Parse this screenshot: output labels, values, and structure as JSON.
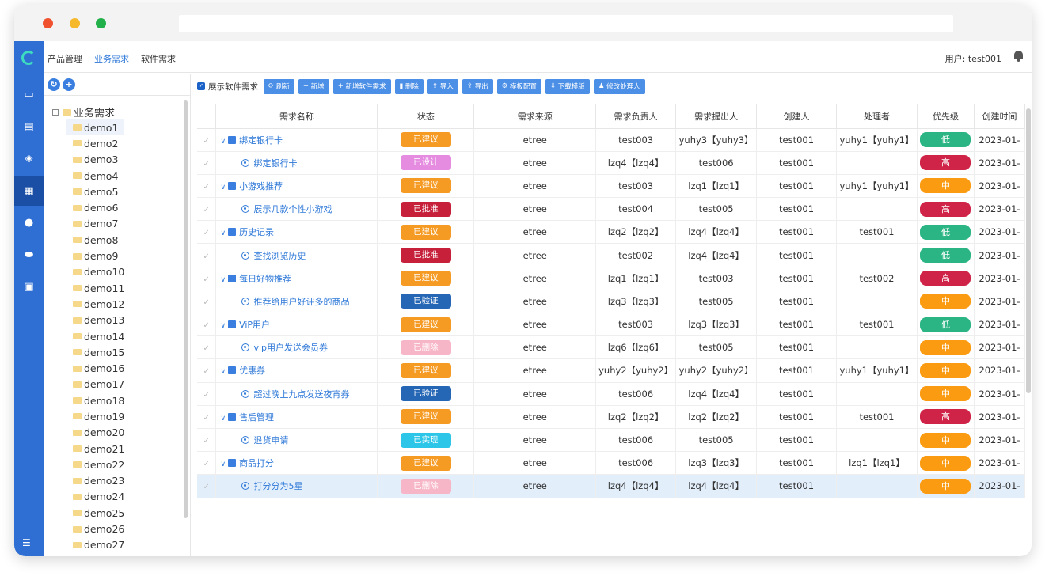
{
  "colors": {
    "brand": "#2f6fd3",
    "status": {
      "已建议": "#f59a23",
      "已设计": "#e58be0",
      "已批准": "#c6203a",
      "已验证": "#2566b5",
      "已删除": "#f7b6c7",
      "已实现": "#2ec6e8"
    },
    "priority": {
      "低": "#2bb584",
      "高": "#cf2448",
      "中": "#fb9b12"
    }
  },
  "window_dots": [
    "#f0512f",
    "#f5b92b",
    "#21b04a"
  ],
  "rail_icons": [
    "logo-icon",
    "monitor-icon",
    "document-icon",
    "layers-icon",
    "server-icon",
    "clock-icon",
    "database-icon",
    "report-icon",
    "menu-icon"
  ],
  "nav": {
    "items": [
      "产品管理",
      "业务需求",
      "软件需求"
    ],
    "active": 1
  },
  "user": {
    "label": "用户: test001"
  },
  "tree": {
    "root": "业务需求",
    "items": [
      "demo1",
      "demo2",
      "demo3",
      "demo4",
      "demo5",
      "demo6",
      "demo7",
      "demo8",
      "demo9",
      "demo10",
      "demo11",
      "demo12",
      "demo13",
      "demo14",
      "demo15",
      "demo16",
      "demo17",
      "demo18",
      "demo19",
      "demo20",
      "demo21",
      "demo22",
      "demo23",
      "demo24",
      "demo25",
      "demo26",
      "demo27"
    ]
  },
  "toolbar": {
    "checkbox_label": "展示软件需求",
    "buttons": [
      "刷新",
      "新增",
      "新增软件需求",
      "删除",
      "导入",
      "导出",
      "模板配置",
      "下载模版",
      "修改处理人"
    ]
  },
  "table": {
    "columns": [
      "需求名称",
      "状态",
      "需求来源",
      "需求负责人",
      "需求提出人",
      "创建人",
      "处理者",
      "优先级",
      "创建时间"
    ],
    "rows": [
      {
        "level": "parent",
        "name": "绑定银行卡",
        "status": "已建议",
        "source": "etree",
        "owner": "test003",
        "proposer": "yuhy3【yuhy3】",
        "creator": "test001",
        "handler": "yuhy1【yuhy1】",
        "priority": "低",
        "created": "2023-01-"
      },
      {
        "level": "child",
        "name": "绑定银行卡",
        "status": "已设计",
        "source": "etree",
        "owner": "lzq4【lzq4】",
        "proposer": "test006",
        "creator": "test001",
        "handler": "",
        "priority": "高",
        "created": "2023-01-"
      },
      {
        "level": "parent",
        "name": "小游戏推荐",
        "status": "已建议",
        "source": "etree",
        "owner": "test003",
        "proposer": "lzq1【lzq1】",
        "creator": "test001",
        "handler": "yuhy1【yuhy1】",
        "priority": "中",
        "created": "2023-01-"
      },
      {
        "level": "child",
        "name": "展示几款个性小游戏",
        "status": "已批准",
        "source": "etree",
        "owner": "test004",
        "proposer": "test005",
        "creator": "test001",
        "handler": "",
        "priority": "高",
        "created": "2023-01-"
      },
      {
        "level": "parent",
        "name": "历史记录",
        "status": "已建议",
        "source": "etree",
        "owner": "lzq2【lzq2】",
        "proposer": "lzq4【lzq4】",
        "creator": "test001",
        "handler": "test001",
        "priority": "低",
        "created": "2023-01-"
      },
      {
        "level": "child",
        "name": "查找浏览历史",
        "status": "已批准",
        "source": "etree",
        "owner": "test002",
        "proposer": "lzq4【lzq4】",
        "creator": "test001",
        "handler": "",
        "priority": "低",
        "created": "2023-01-"
      },
      {
        "level": "parent",
        "name": "每日好物推荐",
        "status": "已建议",
        "source": "etree",
        "owner": "lzq1【lzq1】",
        "proposer": "test003",
        "creator": "test001",
        "handler": "test002",
        "priority": "高",
        "created": "2023-01-"
      },
      {
        "level": "child",
        "name": "推荐给用户好评多的商品",
        "status": "已验证",
        "source": "etree",
        "owner": "lzq3【lzq3】",
        "proposer": "test005",
        "creator": "test001",
        "handler": "",
        "priority": "中",
        "created": "2023-01-"
      },
      {
        "level": "parent",
        "name": "ViP用户",
        "status": "已建议",
        "source": "etree",
        "owner": "test003",
        "proposer": "lzq3【lzq3】",
        "creator": "test001",
        "handler": "test001",
        "priority": "低",
        "created": "2023-01-"
      },
      {
        "level": "child",
        "name": "vip用户发送会员券",
        "status": "已删除",
        "source": "etree",
        "owner": "lzq6【lzq6】",
        "proposer": "test005",
        "creator": "test001",
        "handler": "",
        "priority": "中",
        "created": "2023-01-"
      },
      {
        "level": "parent",
        "name": "优惠券",
        "status": "已建议",
        "source": "etree",
        "owner": "yuhy2【yuhy2】",
        "proposer": "yuhy2【yuhy2】",
        "creator": "test001",
        "handler": "yuhy1【yuhy1】",
        "priority": "中",
        "created": "2023-01-"
      },
      {
        "level": "child",
        "name": "超过晚上九点发送夜宵券",
        "status": "已验证",
        "source": "etree",
        "owner": "test006",
        "proposer": "lzq4【lzq4】",
        "creator": "test001",
        "handler": "",
        "priority": "中",
        "created": "2023-01-"
      },
      {
        "level": "parent",
        "name": "售后管理",
        "status": "已建议",
        "source": "etree",
        "owner": "lzq2【lzq2】",
        "proposer": "lzq2【lzq2】",
        "creator": "test001",
        "handler": "test001",
        "priority": "高",
        "created": "2023-01-"
      },
      {
        "level": "child",
        "name": "退货申请",
        "status": "已实现",
        "source": "etree",
        "owner": "test006",
        "proposer": "test005",
        "creator": "test001",
        "handler": "",
        "priority": "中",
        "created": "2023-01-"
      },
      {
        "level": "parent",
        "name": "商品打分",
        "status": "已建议",
        "source": "etree",
        "owner": "test006",
        "proposer": "lzq3【lzq3】",
        "creator": "test001",
        "handler": "lzq1【lzq1】",
        "priority": "中",
        "created": "2023-01-"
      },
      {
        "level": "child",
        "name": "打分分为5星",
        "status": "已删除",
        "source": "etree",
        "owner": "lzq4【lzq4】",
        "proposer": "lzq4【lzq4】",
        "creator": "test001",
        "handler": "",
        "priority": "中",
        "created": "2023-01-",
        "highlighted": true
      }
    ]
  }
}
